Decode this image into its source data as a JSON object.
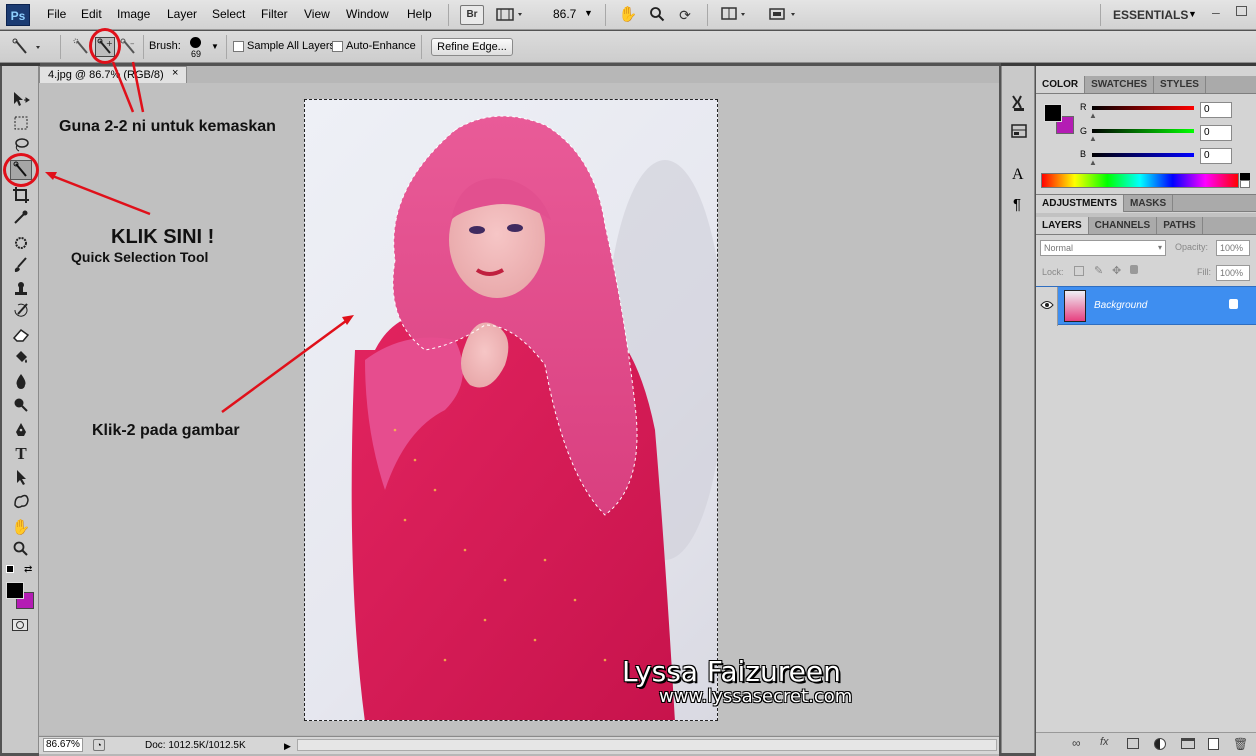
{
  "menubar": {
    "items": [
      "File",
      "Edit",
      "Image",
      "Layer",
      "Select",
      "Filter",
      "View",
      "Window",
      "Help"
    ],
    "bridge_label": "Br",
    "zoom_value": "86.7",
    "workspace": "ESSENTIALS",
    "logo": "Ps"
  },
  "options": {
    "brush_label": "Brush:",
    "brush_size": "69",
    "sample_all_layers": "Sample All Layers",
    "auto_enhance": "Auto-Enhance",
    "refine_edge": "Refine Edge..."
  },
  "document": {
    "tab_title": "4.jpg @ 86.7% (RGB/8)",
    "close": "×",
    "zoom_status": "86.67%",
    "doc_size": "Doc: 1012.5K/1012.5K"
  },
  "annotations": {
    "top": "Guna 2-2 ni untuk kemaskan",
    "klik_sini": "KLIK SINI !",
    "tool_name": "Quick Selection Tool",
    "klik_gambar": "Klik-2 pada gambar"
  },
  "watermark": {
    "name": "Lyssa Faizureen",
    "url": "www.lyssasecret.com"
  },
  "color_panel": {
    "tabs": [
      "COLOR",
      "SWATCHES",
      "STYLES"
    ],
    "r_label": "R",
    "r_value": "0",
    "g_label": "G",
    "g_value": "0",
    "b_label": "B",
    "b_value": "0",
    "fg_color": "#000000",
    "bg_color": "#b41cb4"
  },
  "adjust_panel": {
    "tabs": [
      "ADJUSTMENTS",
      "MASKS"
    ]
  },
  "layers_panel": {
    "tabs": [
      "LAYERS",
      "CHANNELS",
      "PATHS"
    ],
    "blend_mode": "Normal",
    "opacity_label": "Opacity:",
    "opacity_value": "100%",
    "lock_label": "Lock:",
    "fill_label": "Fill:",
    "fill_value": "100%",
    "layer_name": "Background",
    "selected_color": "#3e8ef0"
  },
  "icons": {
    "side_paragraph": "¶",
    "side_char": "A"
  }
}
